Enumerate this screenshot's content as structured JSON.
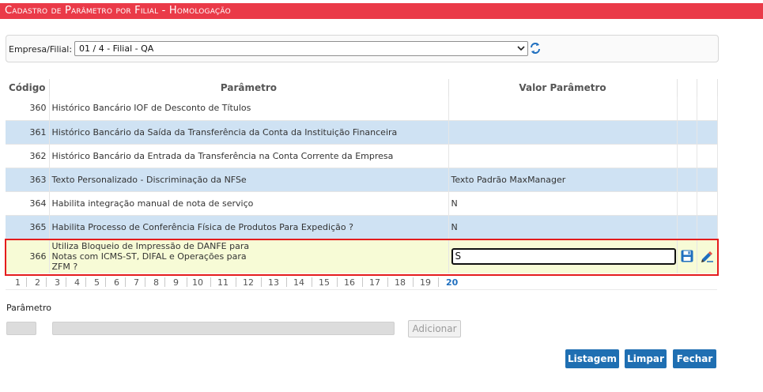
{
  "header": {
    "title": "Cadastro de Parâmetro por Filial  - Homologação"
  },
  "filter": {
    "label": "Empresa/Filial:",
    "selected": "01 / 4 - Filial - QA"
  },
  "grid": {
    "columns": [
      "Código",
      "Parâmetro",
      "Valor Parâmetro"
    ],
    "rows": [
      {
        "code": "360",
        "param": "Histórico Bancário IOF de Desconto de Títulos",
        "value": ""
      },
      {
        "code": "361",
        "param": "Histórico Bancário da Saída da Transferência da Conta da Instituição Financeira",
        "value": ""
      },
      {
        "code": "362",
        "param": "Histórico Bancário da Entrada da Transferência na Conta Corrente da Empresa",
        "value": ""
      },
      {
        "code": "363",
        "param": "Texto Personalizado - Discriminação da NFSe",
        "value": "Texto Padrão MaxManager"
      },
      {
        "code": "364",
        "param": "Habilita integração manual de nota de serviço",
        "value": "N"
      },
      {
        "code": "365",
        "param": "Habilita Processo de Conferência Física de Produtos Para Expedição ?",
        "value": "N"
      }
    ],
    "editing_row": {
      "code": "366",
      "param_lines": [
        "Utiliza Bloqueio de Impressão de DANFE para",
        "Notas com ICMS-ST, DIFAL e Operações para",
        "ZFM ?"
      ],
      "value": "S"
    }
  },
  "pager": {
    "pages": [
      "1",
      "2",
      "3",
      "4",
      "5",
      "6",
      "7",
      "8",
      "9",
      "10",
      "11",
      "12",
      "13",
      "14",
      "15",
      "16",
      "17",
      "18",
      "19",
      "20"
    ],
    "current": "20"
  },
  "form": {
    "label": "Parâmetro",
    "add_label": "Adicionar"
  },
  "buttons": {
    "list": "Listagem",
    "clear": "Limpar",
    "close": "Fechar"
  },
  "colors": {
    "header_bg": "#ea3a48",
    "row_alt": "#cfe2f3",
    "selected_row": "#f7fbd6",
    "selection_border": "#e41c1c",
    "primary_button": "#1f6fb2"
  },
  "icons": {
    "refresh": "refresh-icon",
    "save": "save-icon",
    "edit": "edit-icon",
    "dropdown": "chevron-down-icon"
  }
}
